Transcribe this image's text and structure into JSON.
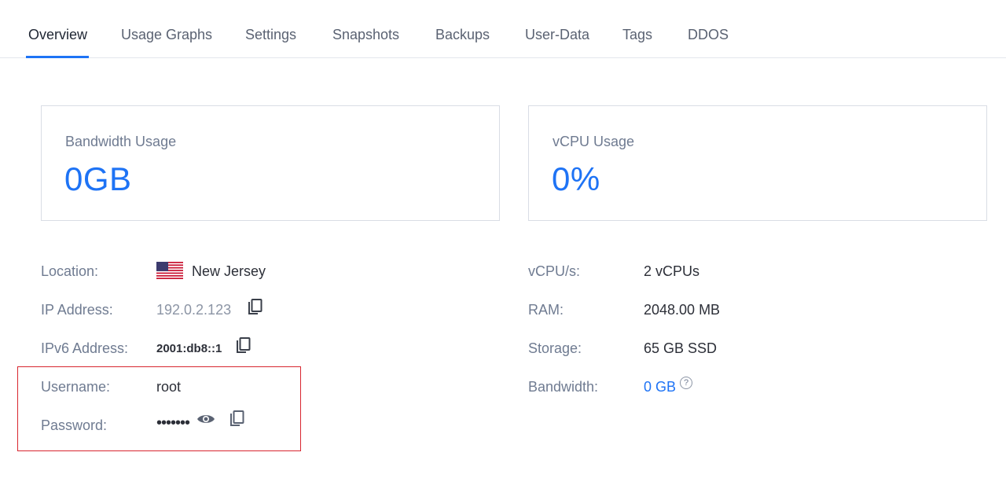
{
  "tabs": [
    {
      "label": "Overview",
      "active": true
    },
    {
      "label": "Usage Graphs",
      "active": false
    },
    {
      "label": "Settings",
      "active": false
    },
    {
      "label": "Snapshots",
      "active": false
    },
    {
      "label": "Backups",
      "active": false
    },
    {
      "label": "User-Data",
      "active": false
    },
    {
      "label": "Tags",
      "active": false
    },
    {
      "label": "DDOS",
      "active": false
    }
  ],
  "cards": {
    "bandwidth": {
      "label": "Bandwidth Usage",
      "value": "0GB"
    },
    "vcpu": {
      "label": "vCPU Usage",
      "value": "0%"
    }
  },
  "details_left": {
    "location": {
      "label": "Location:",
      "value": "New Jersey",
      "flag_icon": "us-flag-icon"
    },
    "ip": {
      "label": "IP Address:",
      "value": "192.0.2.123"
    },
    "ipv6": {
      "label": "IPv6 Address:",
      "value": "2001:db8::1"
    },
    "username": {
      "label": "Username:",
      "value": "root"
    },
    "password": {
      "label": "Password:",
      "value": "•••••••"
    }
  },
  "details_right": {
    "vcpus": {
      "label": "vCPU/s:",
      "value": "2 vCPUs"
    },
    "ram": {
      "label": "RAM:",
      "value": "2048.00 MB"
    },
    "storage": {
      "label": "Storage:",
      "value": "65 GB SSD"
    },
    "bandwidth": {
      "label": "Bandwidth:",
      "value": "0 GB",
      "help": "?"
    }
  },
  "colors": {
    "accent": "#1e73f5",
    "highlight_border": "#d8262f",
    "label": "#6f7b91"
  }
}
